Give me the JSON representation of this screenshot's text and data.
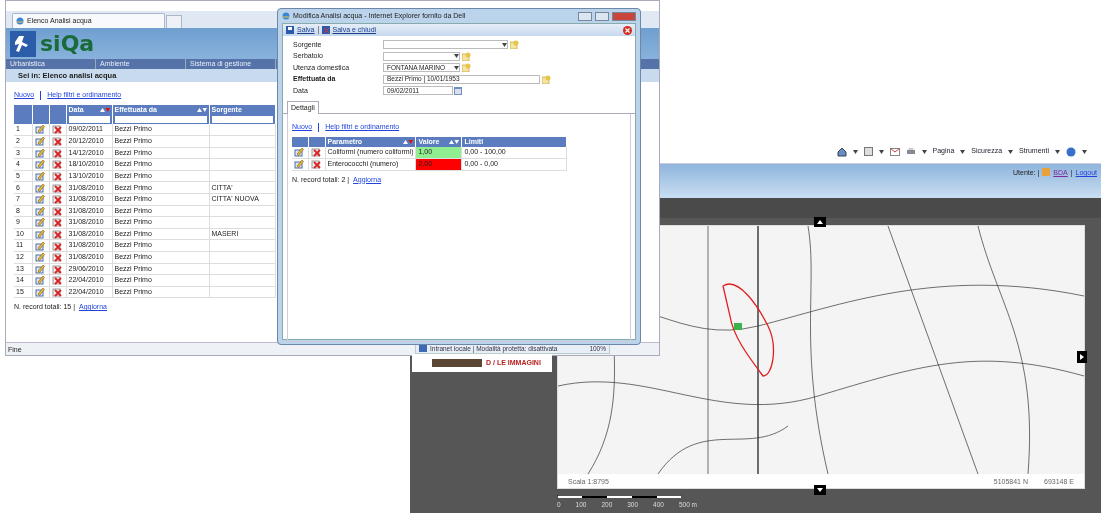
{
  "back_window": {
    "toolbar": [
      {
        "label": "Pagina"
      },
      {
        "label": "Sicurezza"
      },
      {
        "label": "Strumenti"
      }
    ],
    "user_label": "Utente: |",
    "user_name": "BDA",
    "separator": "|",
    "logout": "Logout",
    "status_text": "Intranet locale | Modalità protetta: disattivata",
    "zoom": "100%",
    "gallery_link": "D / LE IMMAGINI",
    "map": {
      "scale": "Scala 1:8795",
      "north": "5105841 N",
      "east": "693148 E",
      "scale_bar_labels": [
        "0",
        "100",
        "200",
        "300",
        "400",
        "500 m"
      ]
    }
  },
  "list_window": {
    "tab_title": "Elenco Analisi acqua",
    "logo": "siQa",
    "menu": [
      "Urbanistica",
      "Ambiente",
      "Sistema di gestione"
    ],
    "breadcrumb": "Sei in: Elenco analisi acqua",
    "links": [
      "Nuovo",
      "Help filtri e ordinamento"
    ],
    "columns": [
      {
        "label": "Data",
        "sortable": true,
        "sorted": true
      },
      {
        "label": "Effettuata da",
        "sortable": true,
        "sorted": false
      },
      {
        "label": "Sorgente",
        "sortable": false
      }
    ],
    "rows": [
      {
        "n": "1",
        "data": "09/02/2011",
        "by": "Bezzi Primo"
      },
      {
        "n": "2",
        "data": "20/12/2010",
        "by": "Bezzi Primo"
      },
      {
        "n": "3",
        "data": "14/12/2010",
        "by": "Bezzi Primo"
      },
      {
        "n": "4",
        "data": "18/10/2010",
        "by": "Bezzi Primo"
      },
      {
        "n": "5",
        "data": "13/10/2010",
        "by": "Bezzi Primo"
      },
      {
        "n": "6",
        "data": "31/08/2010",
        "by": "Bezzi Primo",
        "source": "CITTA'"
      },
      {
        "n": "7",
        "data": "31/08/2010",
        "by": "Bezzi Primo",
        "source": "CITTA' NUOVA"
      },
      {
        "n": "8",
        "data": "31/08/2010",
        "by": "Bezzi Primo"
      },
      {
        "n": "9",
        "data": "31/08/2010",
        "by": "Bezzi Primo"
      },
      {
        "n": "10",
        "data": "31/08/2010",
        "by": "Bezzi Primo",
        "source": "MASERI"
      },
      {
        "n": "11",
        "data": "31/08/2010",
        "by": "Bezzi Primo"
      },
      {
        "n": "12",
        "data": "31/08/2010",
        "by": "Bezzi Primo"
      },
      {
        "n": "13",
        "data": "29/06/2010",
        "by": "Bezzi Primo"
      },
      {
        "n": "14",
        "data": "22/04/2010",
        "by": "Bezzi Primo"
      },
      {
        "n": "15",
        "data": "22/04/2010",
        "by": "Bezzi Primo"
      }
    ],
    "footer_label": "N. record totali: 15 |",
    "refresh": "Aggiorna",
    "status": "Fine"
  },
  "popup": {
    "title": "Modifica Analisi acqua - Internet Explorer fornito da Dell",
    "toolbar": [
      "Salva",
      "Salva e chiudi"
    ],
    "fields": [
      {
        "label": "Sorgente",
        "kind": "select"
      },
      {
        "label": "Serbatoio",
        "kind": "select"
      },
      {
        "label": "Utenza domestica",
        "kind": "select",
        "value": "FONTANA MARINO"
      },
      {
        "label": "Effettuata da",
        "kind": "text",
        "value": "Bezzi Primo | 10/01/1953",
        "bold": true
      },
      {
        "label": "Data",
        "kind": "date",
        "value": "09/02/2011"
      }
    ],
    "tabs": [
      {
        "label": "Dettagli",
        "selected": true
      }
    ],
    "links": [
      "Nuovo",
      "Help filtri e ordinamento"
    ],
    "columns": [
      {
        "label": "Parametro",
        "sortable": true,
        "sorted": true
      },
      {
        "label": "Valore",
        "sortable": true,
        "sorted": false
      },
      {
        "label": "Limiti",
        "sortable": false
      }
    ],
    "rows": [
      {
        "parametro": "Coliformi (numero coliformi)",
        "valore": "1,00",
        "color": "#90ee90",
        "limiti": "0,00 - 100,00"
      },
      {
        "parametro": "Enterococchi (numero)",
        "valore": "2,00",
        "color": "#ff0000",
        "limiti": "0,00 - 0,00"
      }
    ],
    "footer_label": "N. record totali: 2 |",
    "refresh": "Aggiorna"
  }
}
